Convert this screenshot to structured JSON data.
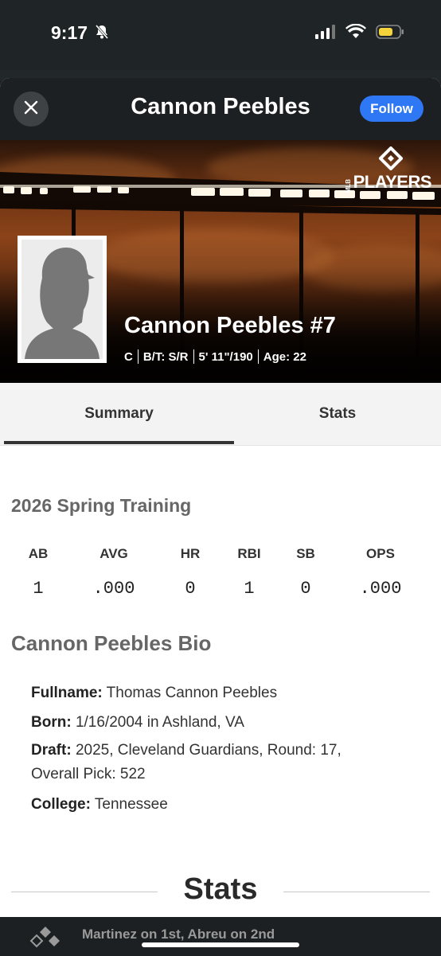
{
  "status_bar": {
    "time": "9:17"
  },
  "header": {
    "title": "Cannon Peebles",
    "follow_label": "Follow"
  },
  "hero": {
    "logo_small": "MLB",
    "logo_text": "PLAYERS",
    "player_name": "Cannon Peebles #7",
    "position": "C",
    "bats_throws": "B/T: S/R",
    "height_weight": "5' 11\"/190",
    "age": "Age: 22"
  },
  "tabs": [
    {
      "label": "Summary"
    },
    {
      "label": "Stats"
    }
  ],
  "spring_training": {
    "title": "2026 Spring Training",
    "headers": [
      "AB",
      "AVG",
      "HR",
      "RBI",
      "SB",
      "OPS"
    ],
    "values": [
      "1",
      ".000",
      "0",
      "1",
      "0",
      ".000"
    ]
  },
  "bio": {
    "title": "Cannon Peebles Bio",
    "fullname_label": "Fullname:",
    "fullname": "Thomas Cannon Peebles",
    "born_label": "Born:",
    "born": "1/16/2004 in Ashland, VA",
    "draft_label": "Draft:",
    "draft_line1": "2025, Cleveland Guardians, Round: 17,",
    "draft_line2": "Overall Pick: 522",
    "college_label": "College:",
    "college": "Tennessee"
  },
  "stats_heading": "Stats",
  "bottom_bar": {
    "ticker": "Martinez on 1st, Abreu on 2nd"
  }
}
